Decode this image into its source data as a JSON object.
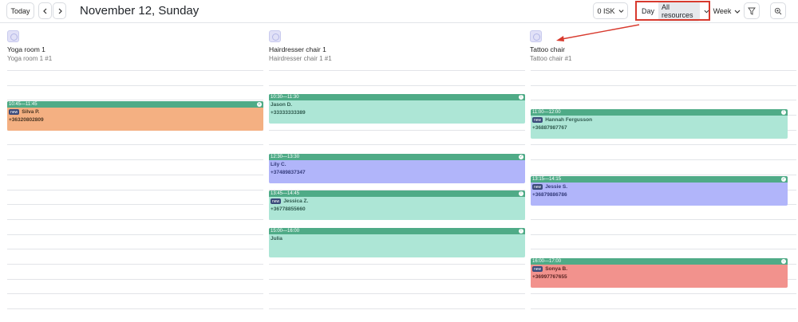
{
  "toolbar": {
    "today_label": "Today",
    "prev_icon": "chevron-left-icon",
    "next_icon": "chevron-right-icon",
    "date_title": "November 12, Sunday",
    "currency_label": "0 ISK",
    "day_label": "Day",
    "resources_label": "All resources",
    "view_label": "Week",
    "filter_icon": "filter-icon",
    "zoom_icon": "zoom-icon"
  },
  "resources": [
    {
      "name": "Yoga room 1",
      "sub": "Yoga room 1 #1"
    },
    {
      "name": "Hairdresser chair 1",
      "sub": "Hairdresser chair 1 #1"
    },
    {
      "name": "Tattoo chair",
      "sub": "Tattoo chair #1"
    }
  ],
  "events": [
    {
      "time": "10:45—11:45",
      "badge": "new",
      "name": "Silva P.",
      "phone": "+36320802809"
    },
    {
      "time": "10:30—11:30",
      "name": "Jason D.",
      "phone": "+33333333389"
    },
    {
      "time": "12:30—13:30",
      "name": "Lily C.",
      "phone": "+37489837347"
    },
    {
      "time": "13:45—14:45",
      "badge": "new",
      "name": "Jessica Z.",
      "phone": "+36778855660"
    },
    {
      "time": "15:00—16:00",
      "name": "Julia"
    },
    {
      "time": "11:00—12:00",
      "badge": "new",
      "name": "Hannah Fergusson",
      "phone": "+36887987767"
    },
    {
      "time": "13:15—14:15",
      "badge": "new",
      "name": "Jessie S.",
      "phone": "+36879886786"
    },
    {
      "time": "16:00—17:00",
      "badge": "new",
      "name": "Sonya B.",
      "phone": "+36997767655"
    }
  ],
  "colors": {
    "accent": "#4fab87",
    "annotation": "#d83a2e"
  }
}
